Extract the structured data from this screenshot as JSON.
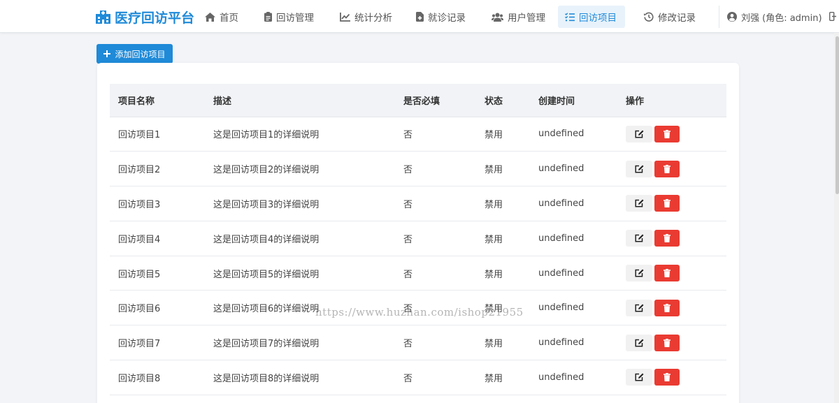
{
  "brand": {
    "title": "医疗回访平台",
    "color": "#1f8ad8"
  },
  "nav": {
    "items": [
      {
        "label": "首页",
        "icon": "home-icon"
      },
      {
        "label": "回访管理",
        "icon": "clipboard-icon"
      },
      {
        "label": "统计分析",
        "icon": "chart-line-icon"
      },
      {
        "label": "就诊记录",
        "icon": "file-medical-icon"
      },
      {
        "label": "用户管理",
        "icon": "users-icon"
      },
      {
        "label": "回访项目",
        "icon": "list-check-icon",
        "active": true
      },
      {
        "label": "修改记录",
        "icon": "history-icon"
      }
    ],
    "user": "刘强 (角色: admin)"
  },
  "toolbar": {
    "add_label": "添加回访项目"
  },
  "table": {
    "headers": [
      "项目名称",
      "描述",
      "是否必填",
      "状态",
      "创建时间",
      "操作"
    ],
    "rows": [
      {
        "name": "回访项目1",
        "desc": "这是回访项目1的详细说明",
        "required": "否",
        "status": "禁用",
        "created": "undefined"
      },
      {
        "name": "回访项目2",
        "desc": "这是回访项目2的详细说明",
        "required": "否",
        "status": "禁用",
        "created": "undefined"
      },
      {
        "name": "回访项目3",
        "desc": "这是回访项目3的详细说明",
        "required": "否",
        "status": "禁用",
        "created": "undefined"
      },
      {
        "name": "回访项目4",
        "desc": "这是回访项目4的详细说明",
        "required": "否",
        "status": "禁用",
        "created": "undefined"
      },
      {
        "name": "回访项目5",
        "desc": "这是回访项目5的详细说明",
        "required": "否",
        "status": "禁用",
        "created": "undefined"
      },
      {
        "name": "回访项目6",
        "desc": "这是回访项目6的详细说明",
        "required": "否",
        "status": "禁用",
        "created": "undefined"
      },
      {
        "name": "回访项目7",
        "desc": "这是回访项目7的详细说明",
        "required": "否",
        "status": "禁用",
        "created": "undefined"
      },
      {
        "name": "回访项目8",
        "desc": "这是回访项目8的详细说明",
        "required": "否",
        "status": "禁用",
        "created": "undefined"
      }
    ]
  },
  "watermark": "https://www.huzhan.com/ishop21955",
  "colors": {
    "primary": "#1f8ad8",
    "danger": "#ea3b32"
  }
}
